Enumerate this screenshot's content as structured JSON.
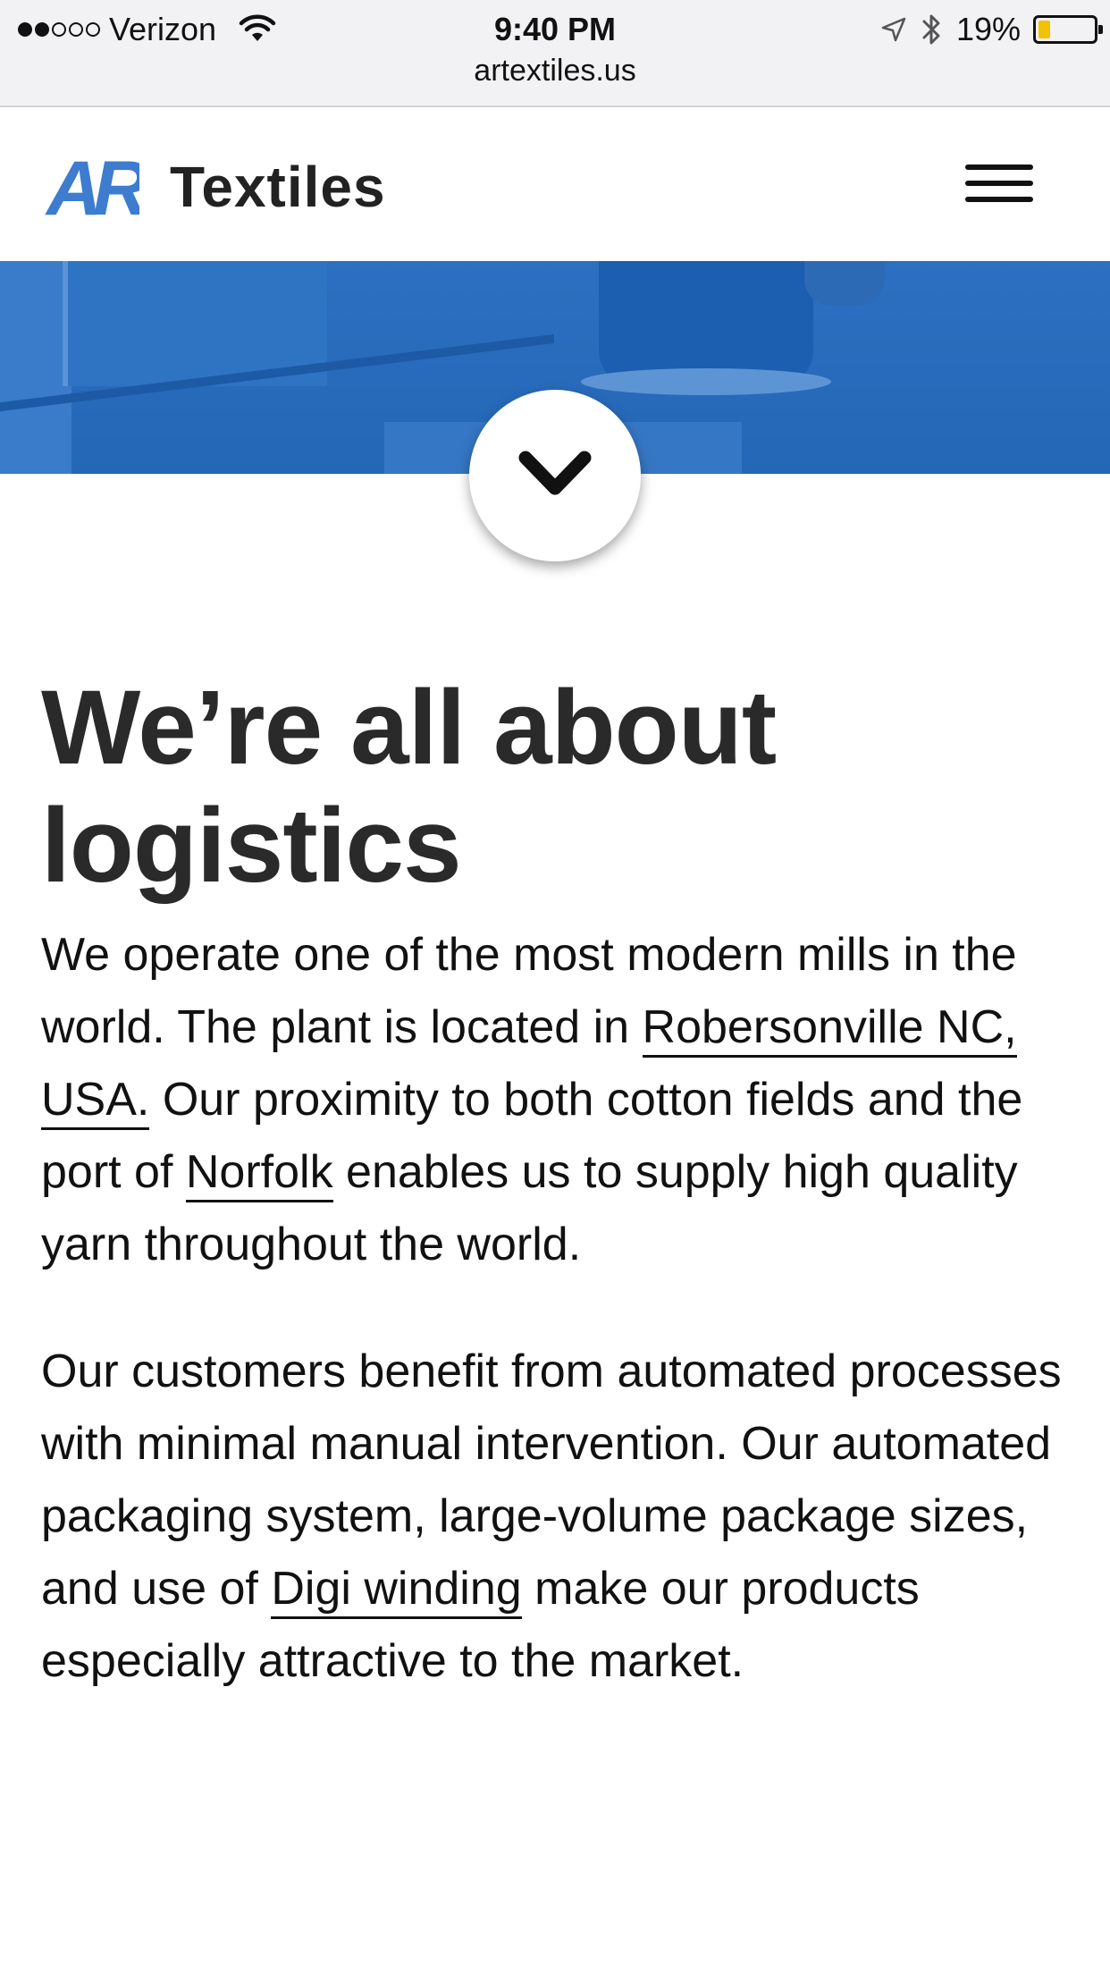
{
  "status_bar": {
    "carrier": "Verizon",
    "time": "9:40 PM",
    "battery": "19%",
    "battery_level": 0.19,
    "url": "artextiles.us"
  },
  "header": {
    "logo_text": "AR",
    "brand": "Textiles"
  },
  "content": {
    "headline": "We’re all about logistics",
    "para1": {
      "t1": "We operate one of the most modern mills in the world. The plant is located in ",
      "link1": "Robersonville NC, USA.",
      "t2": " Our proximity to both cotton fields and the port of ",
      "link2": "Norfolk",
      "t3": " enables us to supply high quality yarn throughout the world."
    },
    "para2": {
      "t1": "Our customers benefit from automated processes with minimal manual intervention. Our automated packaging system, large-volume package sizes, and use of ",
      "link1": "Digi winding",
      "t2": " make our products especially attractive to the market."
    }
  },
  "colors": {
    "hero_blue": "#2467b7",
    "logo_blue": "#3d7ccf",
    "battery_yellow": "#f2c200"
  },
  "icons": [
    "wifi-icon",
    "location-arrow-icon",
    "bluetooth-icon",
    "battery-icon",
    "menu-icon",
    "chevron-down-icon"
  ]
}
